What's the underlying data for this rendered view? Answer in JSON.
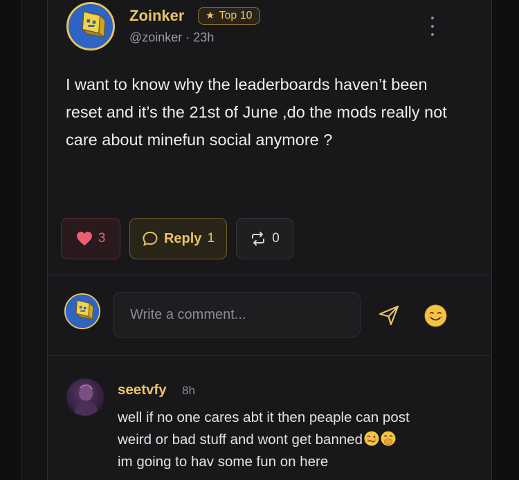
{
  "post": {
    "author_name": "Zoinker",
    "badge_label": "Top 10",
    "author_meta": "@zoinker · 23h",
    "body": "I want to know why the leaderboards haven’t been reset and it’s the 21st of June ,do the mods really not care about minefun social anymore ?",
    "actions": {
      "like_count": "3",
      "reply_label": "Reply",
      "reply_count": "1",
      "repost_count": "0"
    }
  },
  "composer": {
    "placeholder": "Write a comment..."
  },
  "comments": [
    {
      "author": "seetvfy",
      "time": "8h",
      "line1": "well if no one cares abt it then peaple can post",
      "line2": "weird or bad stuff and wont get banned",
      "line3": "im going to hav some fun on here",
      "emojis": [
        "woozy-face",
        "hand-over-mouth-face"
      ]
    }
  ],
  "colors": {
    "accent": "#e9c46a",
    "like": "#ee5d72",
    "background": "#18181b"
  },
  "icons": [
    "more-vertical-icon",
    "star-icon",
    "heart-icon",
    "speech-bubble-icon",
    "repost-icon",
    "send-icon",
    "smiley-emoji-icon"
  ]
}
